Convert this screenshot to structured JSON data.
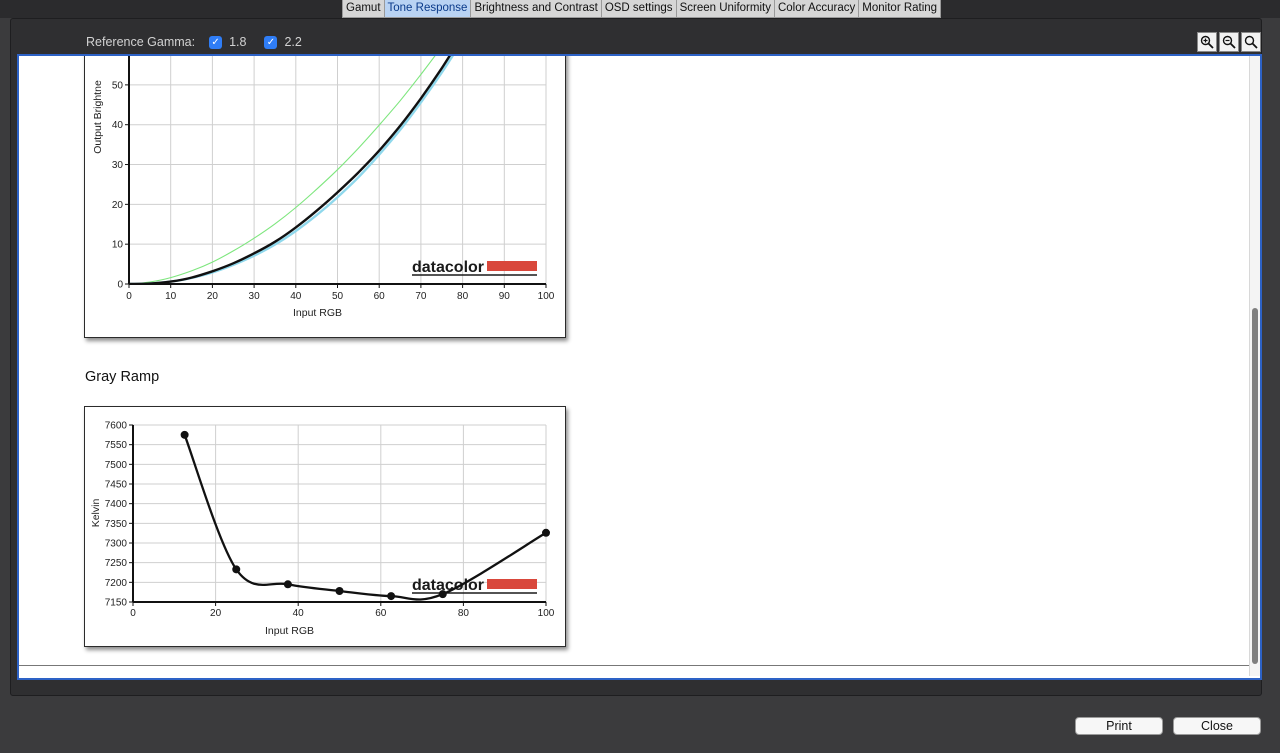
{
  "tabs": [
    {
      "label": "Gamut",
      "active": false
    },
    {
      "label": "Tone Response",
      "active": true
    },
    {
      "label": "Brightness and Contrast",
      "active": false
    },
    {
      "label": "OSD settings",
      "active": false
    },
    {
      "label": "Screen Uniformity",
      "active": false
    },
    {
      "label": "Color Accuracy",
      "active": false
    },
    {
      "label": "Monitor Rating",
      "active": false
    }
  ],
  "reference": {
    "label": "Reference Gamma:",
    "options": [
      {
        "label": "1.8",
        "checked": true
      },
      {
        "label": "2.2",
        "checked": true
      }
    ]
  },
  "zoom": {
    "icons": [
      "zoom-in-icon",
      "zoom-out-icon",
      "zoom-reset-icon"
    ]
  },
  "gray_ramp_title": "Gray Ramp",
  "brand": {
    "logo_text": "datacolor",
    "logo_color": "#d9473b"
  },
  "footer": {
    "print_label": "Print",
    "close_label": "Close"
  },
  "colors": {
    "accent": "#2f7df6",
    "tab_active": "#b9d3f3",
    "gamma18": "#7de67d",
    "gamma22": "#8fd8ec",
    "measured": "#111111"
  },
  "chart_data": [
    {
      "type": "line",
      "title": "",
      "xlabel": "Input RGB",
      "ylabel": "Output Brightne",
      "xlim": [
        0,
        100
      ],
      "ylim_visible": [
        0,
        57
      ],
      "x_ticks": [
        0,
        10,
        20,
        30,
        40,
        50,
        60,
        70,
        80,
        90,
        100
      ],
      "y_ticks": [
        0,
        10,
        20,
        30,
        40,
        50
      ],
      "grid": true,
      "series": [
        {
          "name": "1.8",
          "color": "#7de67d",
          "x": [
            0,
            5,
            10,
            15,
            20,
            25,
            30,
            35,
            40,
            45,
            50,
            55,
            60,
            65,
            70,
            75,
            80
          ],
          "y": [
            0,
            0.5,
            1.6,
            3.3,
            5.5,
            8.3,
            11.5,
            15.1,
            19.2,
            23.8,
            28.7,
            34.1,
            39.9,
            46.0,
            52.6,
            59.6,
            67.0
          ]
        },
        {
          "name": "2.2",
          "color": "#8fd8ec",
          "x": [
            0,
            5,
            10,
            15,
            20,
            25,
            30,
            35,
            40,
            45,
            50,
            55,
            60,
            65,
            70,
            75,
            80
          ],
          "y": [
            0,
            0.1,
            0.6,
            1.5,
            2.9,
            4.8,
            7.1,
            9.9,
            13.3,
            17.3,
            21.8,
            26.8,
            32.5,
            38.7,
            45.6,
            53.1,
            61.2
          ]
        },
        {
          "x": [
            0,
            5,
            10,
            15,
            20,
            25,
            30,
            35,
            40,
            45,
            50,
            55,
            60,
            65,
            70,
            75,
            80
          ],
          "y": [
            0,
            0.1,
            0.6,
            1.6,
            3.2,
            5.2,
            7.7,
            10.6,
            14.2,
            18.4,
            23.0,
            28.0,
            33.5,
            39.7,
            46.6,
            54.2,
            62.5
          ]
        }
      ]
    },
    {
      "type": "line",
      "title": "",
      "xlabel": "Input RGB",
      "ylabel": "Kelvin",
      "xlim": [
        0,
        100
      ],
      "ylim": [
        7150,
        7600
      ],
      "x_ticks": [
        0,
        20,
        40,
        60,
        80,
        100
      ],
      "y_ticks": [
        7150,
        7200,
        7250,
        7300,
        7350,
        7400,
        7450,
        7500,
        7550,
        7600
      ],
      "grid": true,
      "series": [
        {
          "markers": true,
          "x": [
            12.5,
            25,
            37.5,
            50,
            62.5,
            75,
            100
          ],
          "y": [
            7575,
            7233,
            7195,
            7178,
            7165,
            7170,
            7326
          ]
        }
      ]
    }
  ]
}
